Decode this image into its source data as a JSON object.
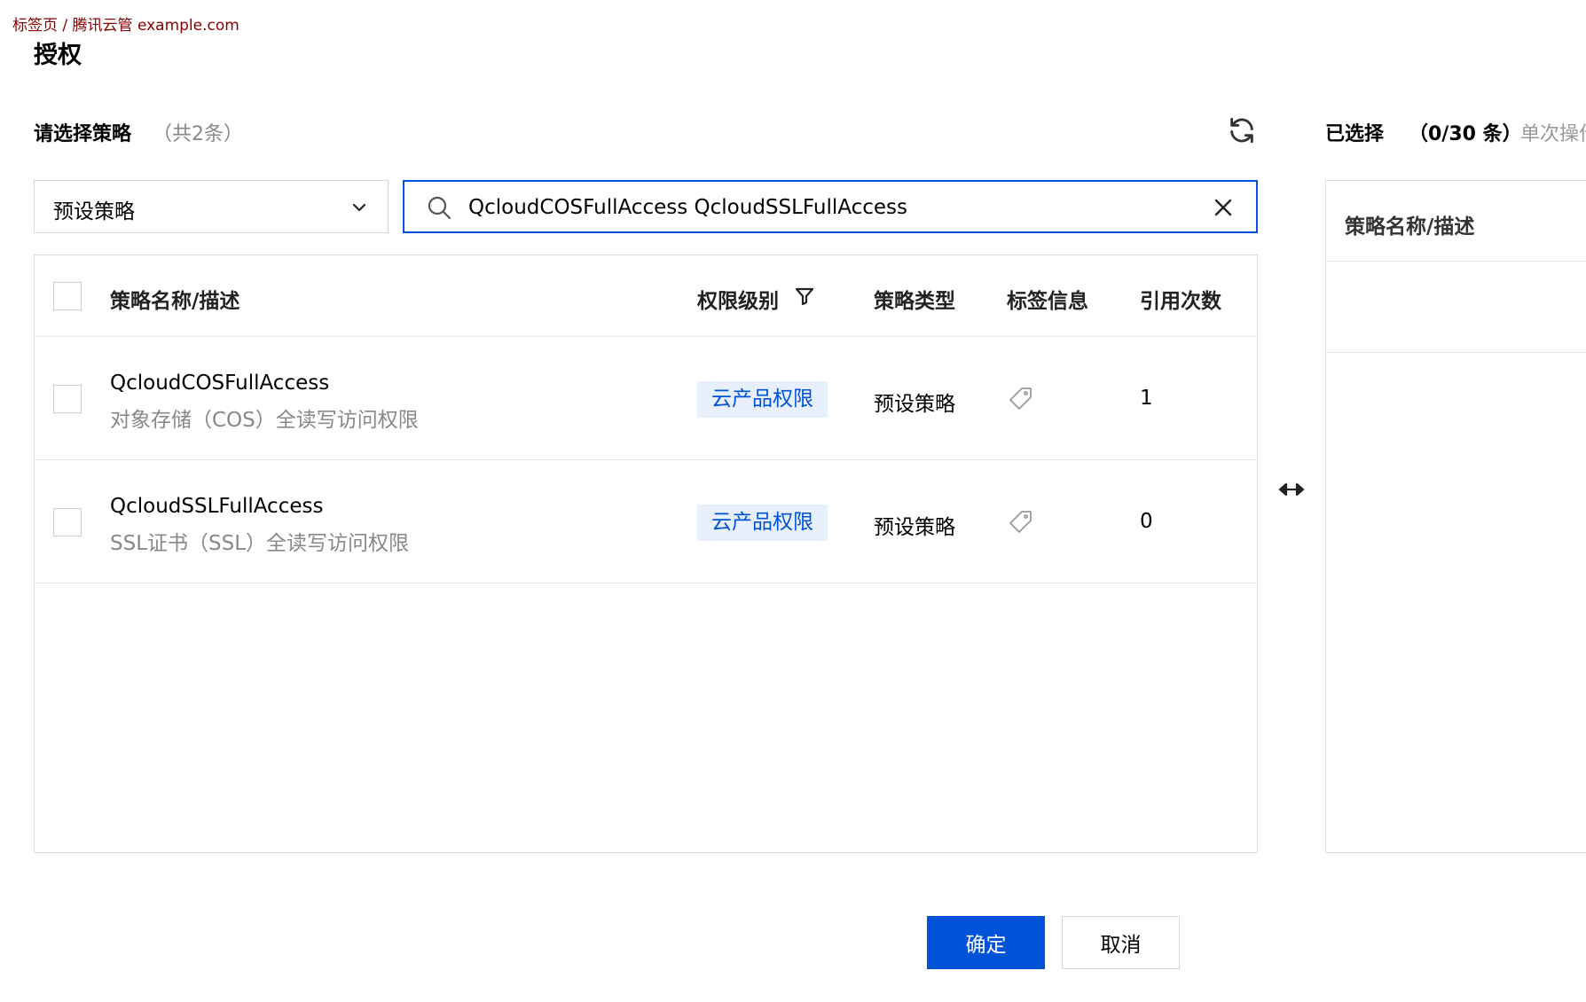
{
  "overlay": "标签页 / 腾讯云管 example.com",
  "dialog": {
    "title": "授权"
  },
  "left": {
    "title": "请选择策略",
    "count": "（共2条）",
    "dropdown_value": "预设策略",
    "search_value": "QcloudCOSFullAccess QcloudSSLFullAccess",
    "columns": {
      "name": "策略名称/描述",
      "level": "权限级别",
      "type": "策略类型",
      "tags": "标签信息",
      "refs": "引用次数"
    },
    "rows": [
      {
        "name": "QcloudCOSFullAccess",
        "desc": "对象存储（COS）全读写访问权限",
        "level": "云产品权限",
        "type": "预设策略",
        "refs": "1"
      },
      {
        "name": "QcloudSSLFullAccess",
        "desc": "SSL证书（SSL）全读写访问权限",
        "level": "云产品权限",
        "type": "预设策略",
        "refs": "0"
      }
    ]
  },
  "right": {
    "title": "已选择",
    "count": "（0/30 条）",
    "note": "单次操作",
    "column": "策略名称/描述"
  },
  "buttons": {
    "confirm": "确定",
    "cancel": "取消"
  },
  "colors": {
    "primary": "#0052d9",
    "tag_bg": "#e8f0fe"
  },
  "icons": [
    "refresh-icon",
    "chevron-down-icon",
    "search-icon",
    "close-icon",
    "filter-icon",
    "tag-icon",
    "swap-icon"
  ]
}
